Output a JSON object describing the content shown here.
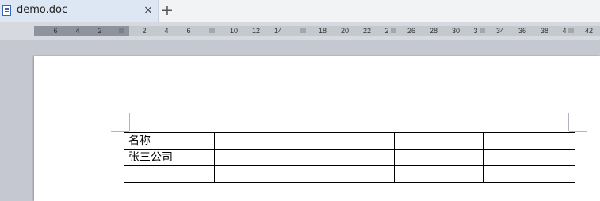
{
  "tab": {
    "title": "demo.doc",
    "close_glyph": "×",
    "new_tab_glyph": "+"
  },
  "ruler": {
    "labels": [
      "6",
      "4",
      "2",
      "2",
      "4",
      "6",
      "10",
      "12",
      "14",
      "18",
      "20",
      "22",
      "2",
      "26",
      "28",
      "30",
      "3",
      "34",
      "36",
      "38",
      "4",
      "42"
    ]
  },
  "table": {
    "rows": [
      [
        "名称",
        "",
        "",
        "",
        ""
      ],
      [
        "张三公司",
        "",
        "",
        "",
        ""
      ],
      [
        "",
        "",
        "",
        "",
        ""
      ]
    ]
  }
}
